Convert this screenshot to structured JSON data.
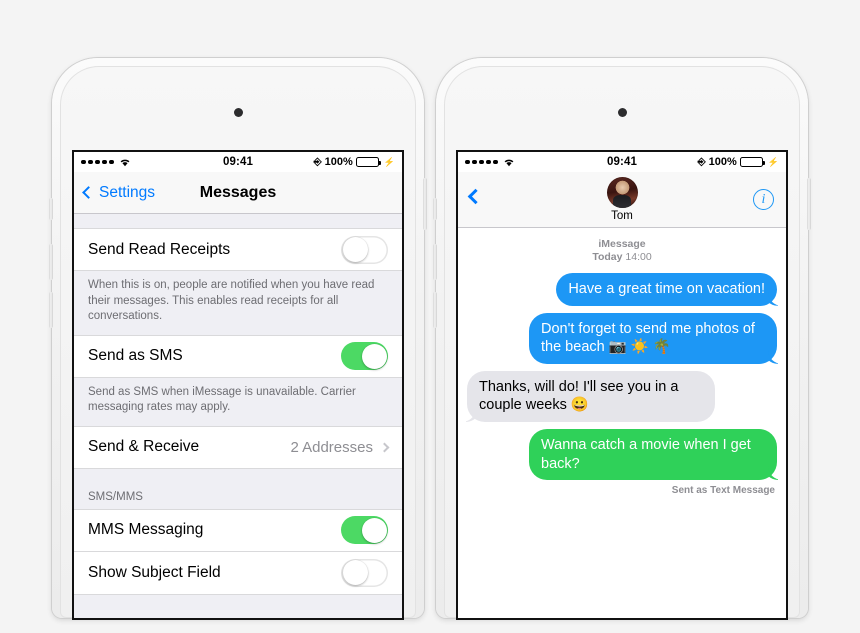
{
  "background_color": "#f4f4f4",
  "colors": {
    "ios_blue": "#007aff",
    "imessage_blue": "#1d97f5",
    "sms_green": "#2fd159",
    "toggle_green": "#4cd964",
    "received_gray": "#e5e5ea",
    "group_bg": "#efeff4",
    "secondary_text": "#6d6d72"
  },
  "status_bar": {
    "signal_dots": 5,
    "wifi_icon": "wifi-icon",
    "time": "09:41",
    "rotation_lock_icon": "rotation-lock-icon",
    "battery_percent": "100%",
    "battery_icon": "battery-icon",
    "charging_icon": "charging-bolt-icon"
  },
  "settings_phone": {
    "nav": {
      "back_label": "Settings",
      "back_icon": "chevron-left-icon",
      "title": "Messages"
    },
    "rows": [
      {
        "label": "Send Read Receipts",
        "control": "toggle",
        "value": "off",
        "footer": "When this is on, people are notified when you have read their messages. This enables read receipts for all conversations."
      },
      {
        "label": "Send as SMS",
        "control": "toggle",
        "value": "on",
        "footer": "Send as SMS when iMessage is unavailable. Carrier messaging rates may apply."
      },
      {
        "label": "Send & Receive",
        "control": "disclosure",
        "value": "2 Addresses",
        "chevron_icon": "chevron-right-icon"
      }
    ],
    "section_header": "SMS/MMS",
    "sms_rows": [
      {
        "label": "MMS Messaging",
        "control": "toggle",
        "value": "on"
      },
      {
        "label": "Show Subject Field",
        "control": "toggle",
        "value": "off"
      }
    ]
  },
  "messages_phone": {
    "nav": {
      "back_icon": "chevron-left-icon",
      "avatar_icon": "contact-avatar",
      "contact_name": "Tom",
      "info_icon": "info-icon"
    },
    "thread_stamp": {
      "service": "iMessage",
      "day": "Today",
      "time": "14:00"
    },
    "messages": [
      {
        "direction": "outgoing",
        "style": "imessage",
        "text": "Have a great time on vacation!"
      },
      {
        "direction": "outgoing",
        "style": "imessage",
        "text": "Don't forget to send me photos of the beach 📷 ☀️ 🌴"
      },
      {
        "direction": "incoming",
        "style": "received",
        "text": "Thanks, will do! I'll see you in a couple weeks 😀"
      },
      {
        "direction": "outgoing",
        "style": "sms",
        "text": "Wanna catch a movie when I get back?"
      }
    ],
    "sent_status": "Sent as Text Message"
  }
}
